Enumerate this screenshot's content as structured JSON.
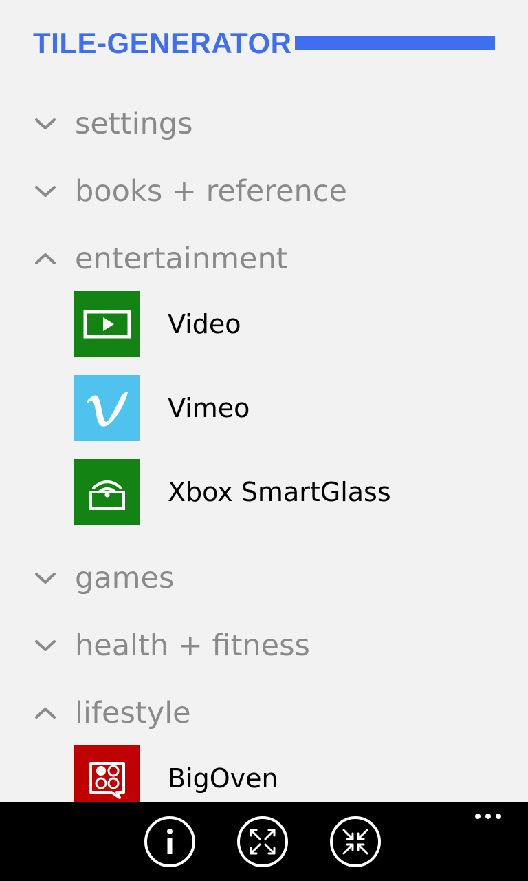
{
  "app": {
    "title": "TILE-GENERATOR",
    "accent_color": "#3f6ef2"
  },
  "categories": [
    {
      "label": "settings",
      "state": "collapsed",
      "icon": "chevron-down-icon"
    },
    {
      "label": "books + reference",
      "state": "collapsed",
      "icon": "chevron-down-icon"
    },
    {
      "label": "entertainment",
      "state": "expanded",
      "icon": "chevron-up-icon"
    },
    {
      "label": "games",
      "state": "collapsed",
      "icon": "chevron-down-icon"
    },
    {
      "label": "health + fitness",
      "state": "collapsed",
      "icon": "chevron-down-icon"
    },
    {
      "label": "lifestyle",
      "state": "expanded",
      "icon": "chevron-up-icon"
    }
  ],
  "apps": {
    "video": {
      "name": "Video",
      "tile_color": "#138313",
      "icon": "video-play-icon"
    },
    "vimeo": {
      "name": "Vimeo",
      "tile_color": "#4fc3ee",
      "icon": "vimeo-v-icon"
    },
    "smartglass": {
      "name": "Xbox SmartGlass",
      "tile_color": "#138313",
      "icon": "smartglass-icon"
    },
    "bigoven": {
      "name": "BigOven",
      "tile_color": "#c00000",
      "icon": "bigoven-icon"
    }
  },
  "appbar": {
    "buttons": [
      {
        "icon": "info-icon"
      },
      {
        "icon": "expand-icon"
      },
      {
        "icon": "collapse-icon"
      }
    ],
    "more_icon": "ellipsis-icon"
  }
}
